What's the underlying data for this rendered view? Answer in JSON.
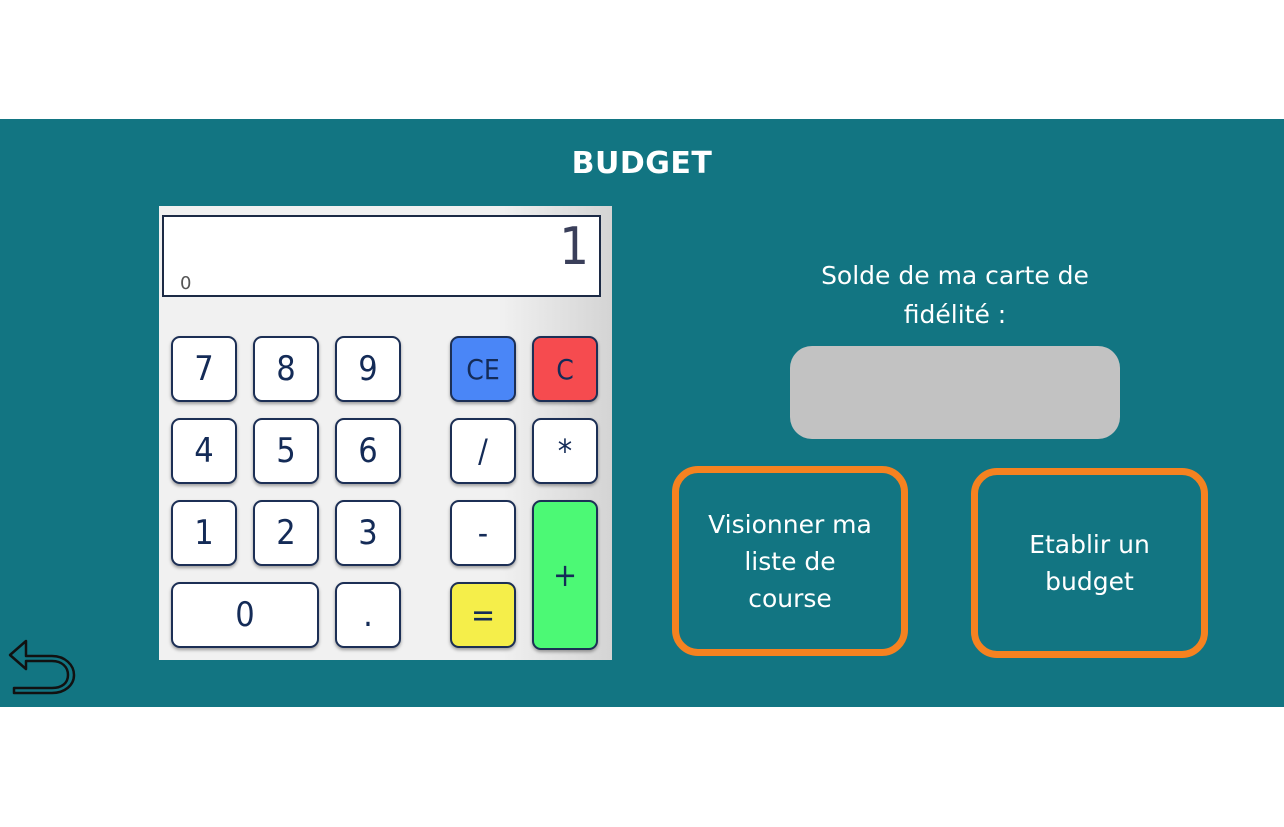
{
  "header": {
    "title": "BUDGET"
  },
  "calculator": {
    "display_value": "1",
    "display_history": "0",
    "keys": {
      "k7": "7",
      "k8": "8",
      "k9": "9",
      "k4": "4",
      "k5": "5",
      "k6": "6",
      "k1": "1",
      "k2": "2",
      "k3": "3",
      "k0": "0",
      "dot": ".",
      "ce": "CE",
      "c": "C",
      "divide": "/",
      "multiply": "*",
      "minus": "-",
      "plus": "+",
      "equals": "="
    },
    "colors": {
      "ce": "#4a86f7",
      "c": "#f64b4f",
      "equals": "#f5ee4a",
      "plus": "#4cf975"
    }
  },
  "balance": {
    "label": "Solde de ma carte de fidélité :",
    "value": ""
  },
  "actions": {
    "view_list": "Visionner ma liste de course",
    "set_budget": "Etablir un budget"
  },
  "icons": {
    "back": "undo-arrow-icon"
  },
  "colors": {
    "panel": "#127582",
    "accent": "#f58220"
  }
}
